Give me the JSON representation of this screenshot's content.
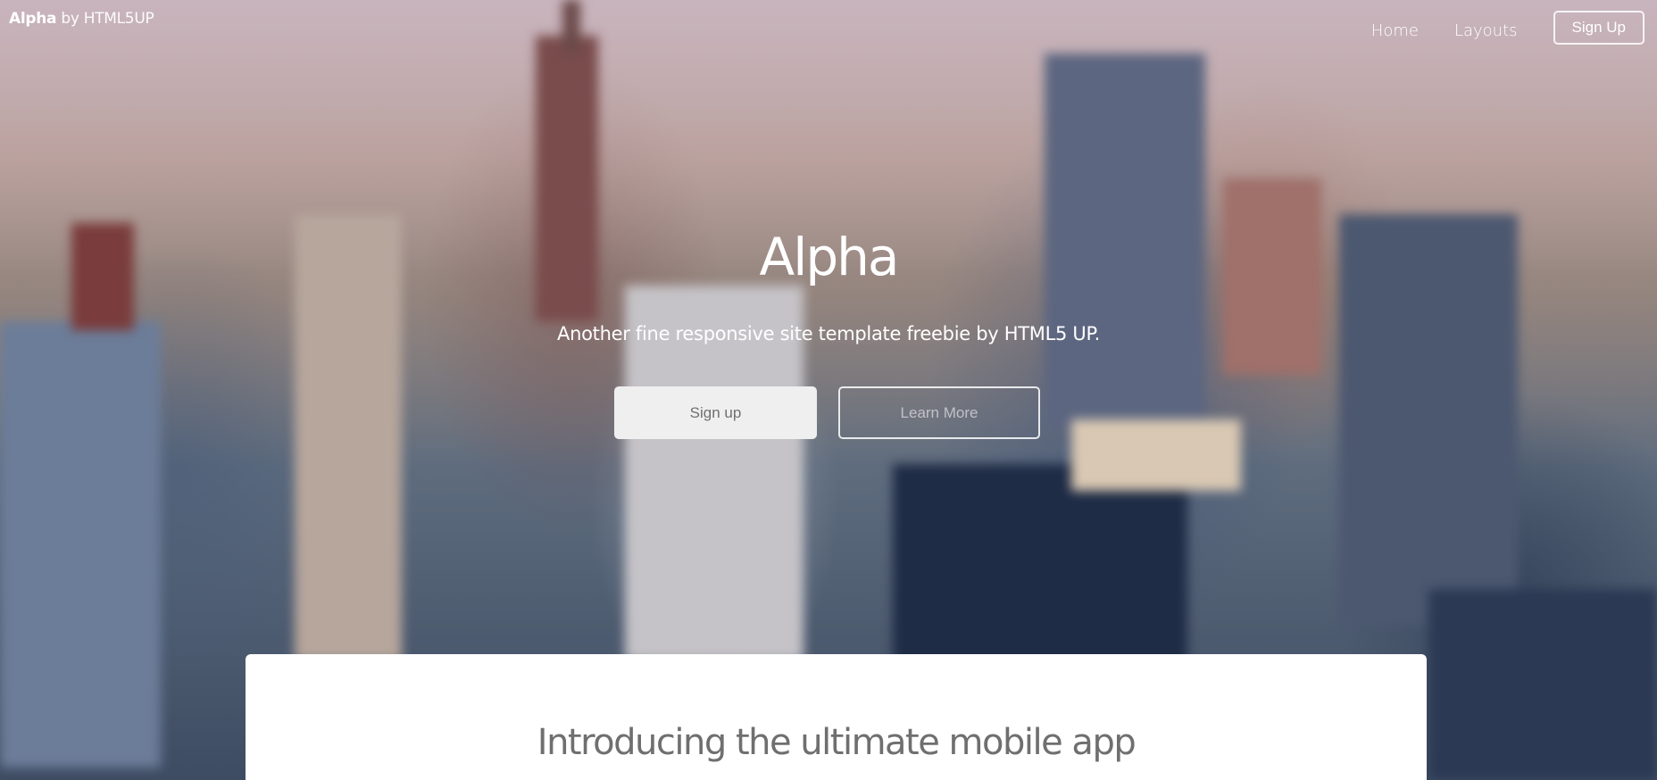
{
  "header": {
    "brand_strong": "Alpha",
    "brand_rest": "by HTML5UP",
    "nav": [
      {
        "label": "Home"
      },
      {
        "label": "Layouts"
      }
    ],
    "signup_label": "Sign Up"
  },
  "hero": {
    "title": "Alpha",
    "subtitle": "Another fine responsive site template freebie by HTML5 UP.",
    "primary_button": "Sign up",
    "secondary_button": "Learn More"
  },
  "main": {
    "heading": "Introducing the ultimate mobile app"
  },
  "colors": {
    "text_on_hero": "#ffffff",
    "primary_button_bg": "#efefef",
    "primary_button_text": "#6f6f6f",
    "heading_text": "#6f6f6f"
  }
}
